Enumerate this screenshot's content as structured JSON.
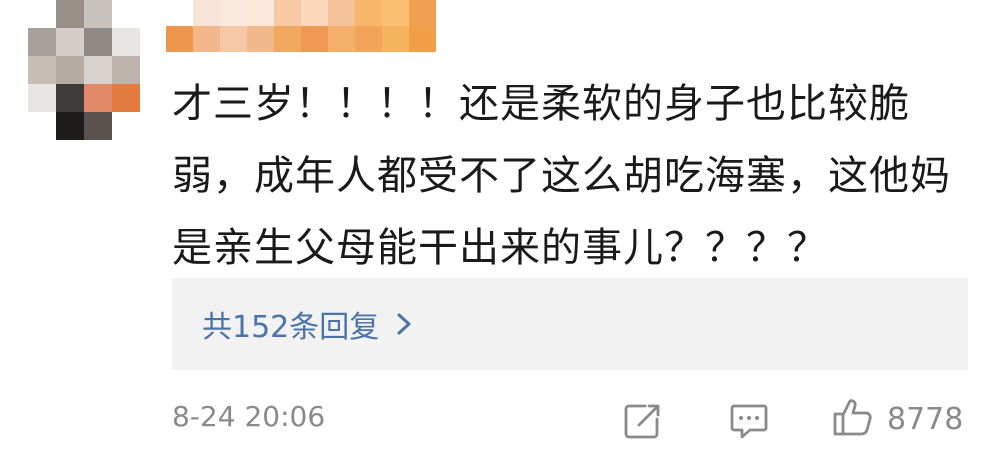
{
  "comment": {
    "text": "才三岁！！！！还是柔软的身子也比较脆弱，成年人都受不了这么胡吃海塞，这他妈是亲生父母能干出来的事儿？？？？",
    "timestamp": "8-24 20:06"
  },
  "replies": {
    "label": "共152条回复"
  },
  "actions": {
    "like_count": "8778",
    "share_icon": "share-icon",
    "comment_icon": "comment-icon",
    "like_icon": "thumbs-up-icon"
  },
  "colors": {
    "text": "#1a1a1a",
    "muted": "#8a8a8a",
    "link": "#4a74a8",
    "reply_bg": "#f2f2f2"
  }
}
